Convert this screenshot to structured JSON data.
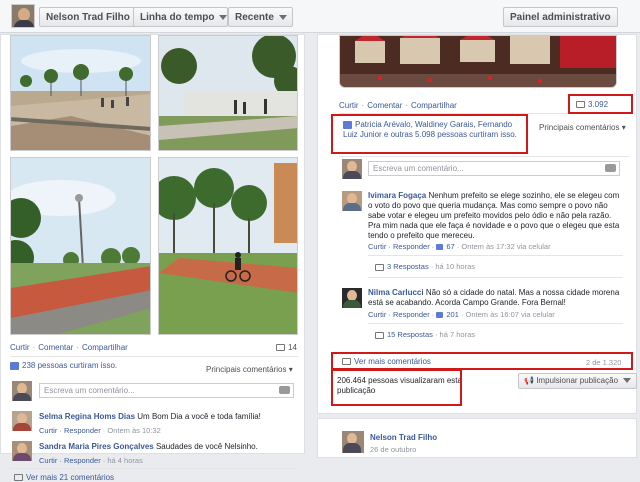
{
  "topbar": {
    "name": "Nelson Trad Filho",
    "timeline": "Linha do tempo",
    "recent": "Recente",
    "admin": "Painel administrativo"
  },
  "left_post": {
    "actions": [
      "Curtir",
      "Comentar",
      "Compartilhar"
    ],
    "comment_count": "14",
    "likes": "238 pessoas curtiram isso.",
    "top_comments": "Principais comentários",
    "comment_placeholder": "Escreva um comentário...",
    "comments": [
      {
        "name": "Selma Regina Homs Dias",
        "text": "Um Bom Dia a você e toda família!",
        "meta_actions": "Curtir · Responder",
        "time": "Ontem às 10:32"
      },
      {
        "name": "Sandra Maria Pires Gonçalves",
        "text": "Saudades de você Nelsinho.",
        "meta_actions": "Curtir · Responder",
        "time": "há 4 horas"
      }
    ],
    "more": "Ver mais 21 comentários"
  },
  "right_post": {
    "actions": [
      "Curtir",
      "Comentar",
      "Compartilhar"
    ],
    "comment_count": "3.092",
    "likes": "Patricia Arévalo, Waldiney Garais, Fernando Luiz Junior e outras 5.098 pessoas curtiram isso.",
    "top_comments": "Principais comentários",
    "comment_placeholder": "Escreva um comentário...",
    "comments": [
      {
        "name": "Ivimara Fogaça",
        "text": "Nenhum prefeito se elege sozinho, ele se elegeu com o voto do povo que queria mudança. Mas como sempre o povo não sabe votar e elegeu um prefeito movidos pelo ódio e não pela razão. Pra mim nada que ele faça é novidade e o povo que o elegeu que esta tendo o prefeito que mereceu.",
        "meta": "Curtir · Responder · ",
        "likes": "67",
        "time": "Ontem às 17:32 via celular",
        "replies": "3 Respostas",
        "replies_time": "há 10 horas"
      },
      {
        "name": "Nilma Carlucci",
        "text": "Não só a cidade do natal. Mas a nossa cidade morena está se acabando. Acorda Campo Grande. Fora Bernal!",
        "meta": "Curtir · Responder · ",
        "likes": "201",
        "time": "Ontem às 16:07 via celular",
        "replies": "15 Respostas",
        "replies_time": "há 7 horas"
      }
    ],
    "more": "Ver mais comentários",
    "pagination": "2 de 1.320",
    "views": "206.464 pessoas visualizaram esta publicação",
    "boost": "Impulsionar publicação"
  },
  "next_post": {
    "name": "Nelson Trad Filho",
    "date": "26 de outubro"
  },
  "colors": {
    "link": "#3b5998",
    "highlight": "#d01a1a"
  }
}
